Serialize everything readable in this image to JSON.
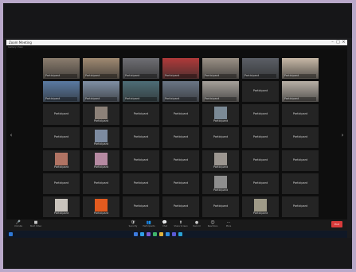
{
  "window": {
    "title": "Zoom Meeting",
    "controls": [
      "–",
      "□",
      "×"
    ]
  },
  "top_indicator": "Gallery View",
  "grid": {
    "tiles": [
      {
        "kind": "video",
        "color": "#8b7d6e",
        "name": "Participant"
      },
      {
        "kind": "video",
        "color": "#a08a72",
        "name": "Participant"
      },
      {
        "kind": "video",
        "color": "#6f6f74",
        "name": "Participant"
      },
      {
        "kind": "video",
        "color": "#b03a3a",
        "name": "Participant"
      },
      {
        "kind": "video",
        "color": "#9b9186",
        "name": "Participant"
      },
      {
        "kind": "video",
        "color": "#5b5f66",
        "name": "Participant"
      },
      {
        "kind": "video",
        "color": "#c7b8a6",
        "name": "Participant"
      },
      {
        "kind": "video",
        "color": "#5a7aa2",
        "name": "Participant"
      },
      {
        "kind": "video",
        "color": "#7f8fa4",
        "name": "Participant"
      },
      {
        "kind": "video",
        "color": "#4d6d76",
        "name": "Participant"
      },
      {
        "kind": "video",
        "color": "#6a7585",
        "name": "Participant"
      },
      {
        "kind": "video",
        "color": "#a5a09a",
        "name": "Participant"
      },
      {
        "kind": "name",
        "name": "Participant"
      },
      {
        "kind": "video",
        "color": "#b8b0a6",
        "name": "Participant"
      },
      {
        "kind": "name",
        "name": "Participant"
      },
      {
        "kind": "thumb",
        "color": "#8c8178",
        "name": "Participant"
      },
      {
        "kind": "name",
        "name": "Participant"
      },
      {
        "kind": "name",
        "name": "Participant"
      },
      {
        "kind": "thumb",
        "color": "#7b8a96",
        "name": "Participant"
      },
      {
        "kind": "name",
        "name": "Participant"
      },
      {
        "kind": "name",
        "name": "Participant"
      },
      {
        "kind": "name",
        "name": "Participant"
      },
      {
        "kind": "thumb",
        "color": "#7d8ba0",
        "name": "Participant"
      },
      {
        "kind": "name",
        "name": "Participant"
      },
      {
        "kind": "name",
        "name": "Participant"
      },
      {
        "kind": "name",
        "name": "Participant"
      },
      {
        "kind": "name",
        "name": "Participant"
      },
      {
        "kind": "name",
        "name": "Participant"
      },
      {
        "kind": "thumb",
        "color": "#b07363",
        "name": "Participant"
      },
      {
        "kind": "thumb",
        "color": "#b68aa2",
        "name": "Participant"
      },
      {
        "kind": "name",
        "name": "Participant"
      },
      {
        "kind": "name",
        "name": "Participant"
      },
      {
        "kind": "thumb",
        "color": "#9c9690",
        "name": "Participant"
      },
      {
        "kind": "name",
        "name": "Participant"
      },
      {
        "kind": "name",
        "name": "Participant"
      },
      {
        "kind": "name",
        "name": "Participant"
      },
      {
        "kind": "name",
        "name": "Participant"
      },
      {
        "kind": "name",
        "name": "Participant"
      },
      {
        "kind": "name",
        "name": "Participant"
      },
      {
        "kind": "thumb",
        "color": "#8e8e8e",
        "name": "Participant"
      },
      {
        "kind": "name",
        "name": "Participant"
      },
      {
        "kind": "name",
        "name": "Participant"
      },
      {
        "kind": "thumb",
        "color": "#c9c4bd",
        "name": "Participant"
      },
      {
        "kind": "thumb",
        "color": "#e35b1f",
        "name": "Participant"
      },
      {
        "kind": "name",
        "name": "Participant"
      },
      {
        "kind": "name",
        "name": "Participant"
      },
      {
        "kind": "name",
        "name": "Participant"
      },
      {
        "kind": "thumb",
        "color": "#9f9a88",
        "name": "Participant"
      },
      {
        "kind": "name",
        "name": "Participant"
      }
    ]
  },
  "controls": {
    "left": [
      {
        "icon": "🎤",
        "label": "Unmute"
      },
      {
        "icon": "■",
        "label": "Start Video"
      }
    ],
    "center": [
      {
        "icon": "🛡",
        "label": "Security"
      },
      {
        "icon": "👥",
        "label": "Participants"
      },
      {
        "icon": "💬",
        "label": "Chat"
      },
      {
        "icon": "⬆",
        "label": "Share Screen"
      },
      {
        "icon": "●",
        "label": "Record"
      },
      {
        "icon": "☺",
        "label": "Reactions"
      },
      {
        "icon": "⋯",
        "label": "More"
      }
    ],
    "end_label": "End"
  },
  "taskbar": {
    "icons": [
      "#3d7be0",
      "#2fa0e8",
      "#7a5cd6",
      "#3fb46b",
      "#e0b23d",
      "#2d8ce0",
      "#5a5ad6",
      "#2aa3d6"
    ],
    "tray_time": "",
    "tray_date": ""
  }
}
